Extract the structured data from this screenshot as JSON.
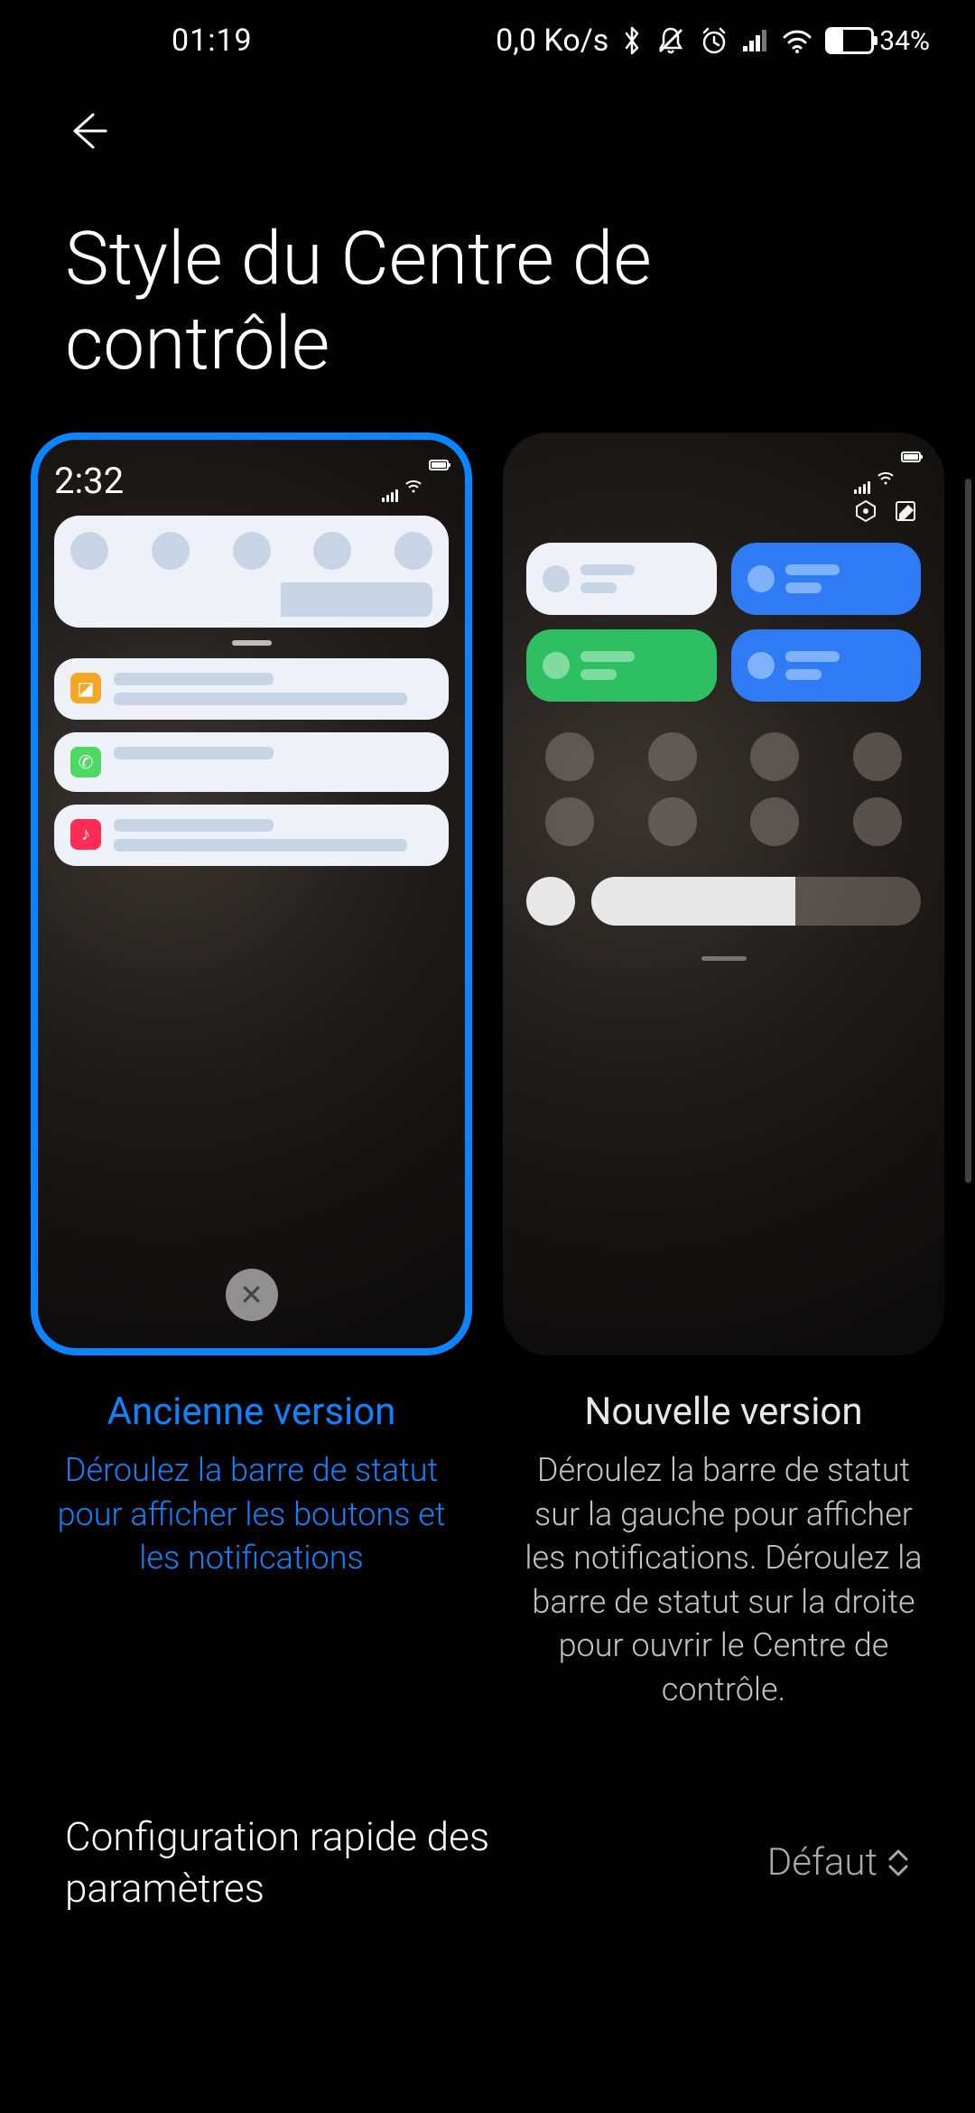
{
  "status_bar": {
    "time": "01:19",
    "data_rate": "0,0 Ko/s",
    "battery_pct": "34%"
  },
  "page_title": "Style du Centre de contrôle",
  "preview": {
    "old_time": "2:32"
  },
  "options": [
    {
      "title": "Ancienne version",
      "desc": "Déroulez la barre de statut pour afficher les boutons et les notifications"
    },
    {
      "title": "Nouvelle version",
      "desc": "Déroulez la barre de statut sur la gauche pour afficher les notifications. Déroulez la barre de statut sur la droite pour ouvrir le Centre de contrôle."
    }
  ],
  "quick_settings": {
    "label": "Configuration rapide des paramètres",
    "value": "Défaut"
  }
}
